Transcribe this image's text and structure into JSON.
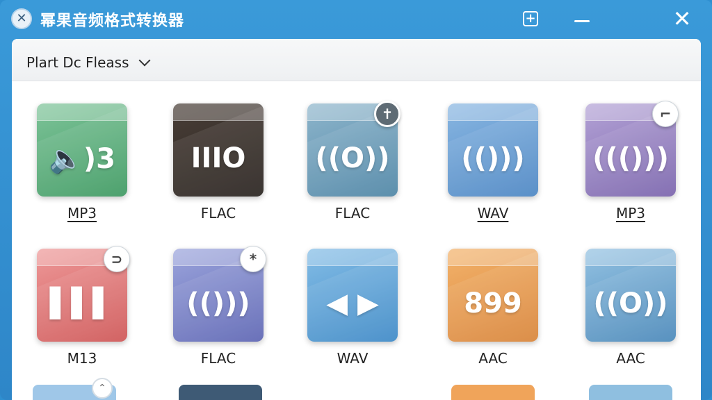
{
  "window": {
    "title": "幂果音频格式转换器"
  },
  "titlebar": {
    "close_glyph": "✕",
    "add_glyph": "+",
    "close_window_glyph": "✕"
  },
  "toolbar": {
    "dropdown_label": "Plart Dc Fleass"
  },
  "tiles": [
    {
      "label": "MP3",
      "underlined": true,
      "color_top": "#7fc49a",
      "color_bottom": "#3f9a62",
      "glyph": "🔈)3",
      "badge": null
    },
    {
      "label": "FLAC",
      "underlined": false,
      "color_top": "#4a3f38",
      "color_bottom": "#2a2420",
      "glyph": "IIIO",
      "badge": null
    },
    {
      "label": "FLAC",
      "underlined": false,
      "color_top": "#8fb6cc",
      "color_bottom": "#4f86a6",
      "glyph": "((O))",
      "badge": {
        "glyph": "✝",
        "style": "dark"
      }
    },
    {
      "label": "WAV",
      "underlined": true,
      "color_top": "#8ab7e2",
      "color_bottom": "#4d87c4",
      "glyph": "(()))",
      "badge": null
    },
    {
      "label": "MP3",
      "underlined": true,
      "color_top": "#b4a3d6",
      "color_bottom": "#7b65ad",
      "glyph": "((()))",
      "badge": {
        "glyph": "⌐",
        "style": "light"
      }
    },
    {
      "label": "M13",
      "underlined": false,
      "color_top": "#ee9a9a",
      "color_bottom": "#cf5757",
      "glyph": "▌▌▌",
      "badge": {
        "glyph": "⊃",
        "style": "light"
      }
    },
    {
      "label": "FLAC",
      "underlined": false,
      "color_top": "#9ca5dc",
      "color_bottom": "#5e66b4",
      "glyph": "(()))",
      "badge": {
        "glyph": "*",
        "style": "light"
      }
    },
    {
      "label": "WAV",
      "underlined": false,
      "color_top": "#84bde6",
      "color_bottom": "#3f8ac7",
      "glyph": "◀ ▶",
      "badge": null
    },
    {
      "label": "AAC",
      "underlined": false,
      "color_top": "#f3b36c",
      "color_bottom": "#d9853a",
      "glyph": "899",
      "badge": null
    },
    {
      "label": "AAC",
      "underlined": false,
      "color_top": "#94c2e2",
      "color_bottom": "#4b89ba",
      "glyph": "((O))",
      "badge": null
    }
  ],
  "partial_row_colors": [
    "#9fc7e8",
    "#3e5a75",
    "#f0a45a",
    "#8fbfe0"
  ],
  "scroll_glyph": "⌃"
}
